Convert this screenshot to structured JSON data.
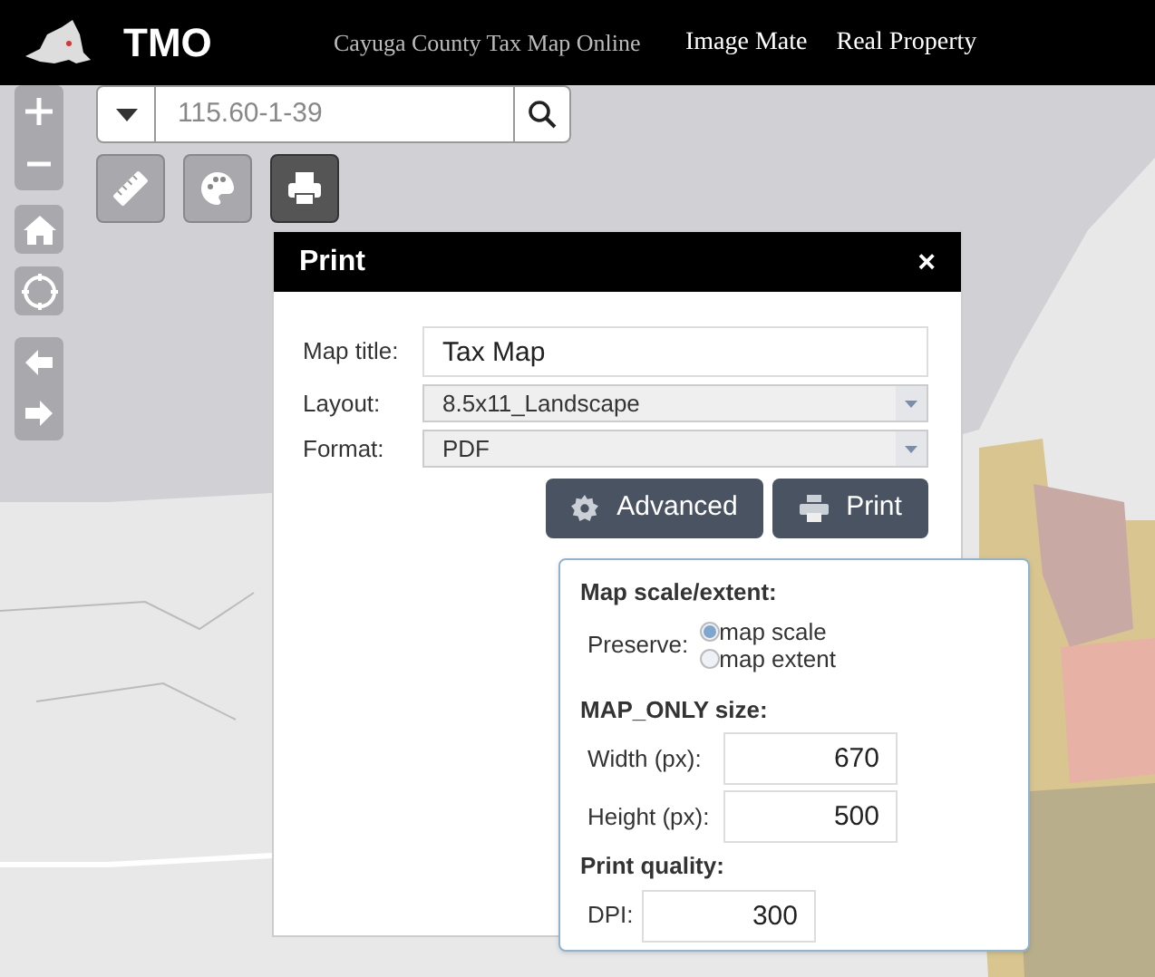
{
  "header": {
    "title": "TMO",
    "subtitle": "Cayuga County Tax Map Online",
    "links": [
      "Image Mate",
      "Real Property"
    ]
  },
  "search": {
    "placeholder": "115.60-1-39"
  },
  "tools": [
    {
      "kind": "ruler",
      "selected": false
    },
    {
      "kind": "palette",
      "selected": false
    },
    {
      "kind": "printer",
      "selected": true
    }
  ],
  "print_dialog": {
    "title": "Print",
    "close": "×",
    "fields": [
      {
        "kind": "text",
        "label": "Map title:",
        "value": "Tax Map"
      },
      {
        "kind": "select",
        "label": "Layout:",
        "value": "8.5x11_Landscape"
      },
      {
        "kind": "select",
        "label": "Format:",
        "value": "PDF"
      }
    ],
    "buttons": [
      {
        "kind": "gear",
        "label": "Advanced"
      },
      {
        "kind": "printer",
        "label": "Print"
      }
    ],
    "advanced": {
      "scale_heading": "Map scale/extent:",
      "preserve_label": "Preserve:",
      "options": [
        {
          "label": "map scale",
          "selected": true
        },
        {
          "label": "map extent",
          "selected": false
        }
      ],
      "size_heading": "MAP_ONLY size:",
      "size_fields": [
        {
          "label": "Width (px):",
          "value": "670"
        },
        {
          "label": "Height (px):",
          "value": "500"
        }
      ],
      "quality_heading": "Print quality:",
      "dpi": {
        "label": "DPI:",
        "value": "300"
      }
    }
  }
}
